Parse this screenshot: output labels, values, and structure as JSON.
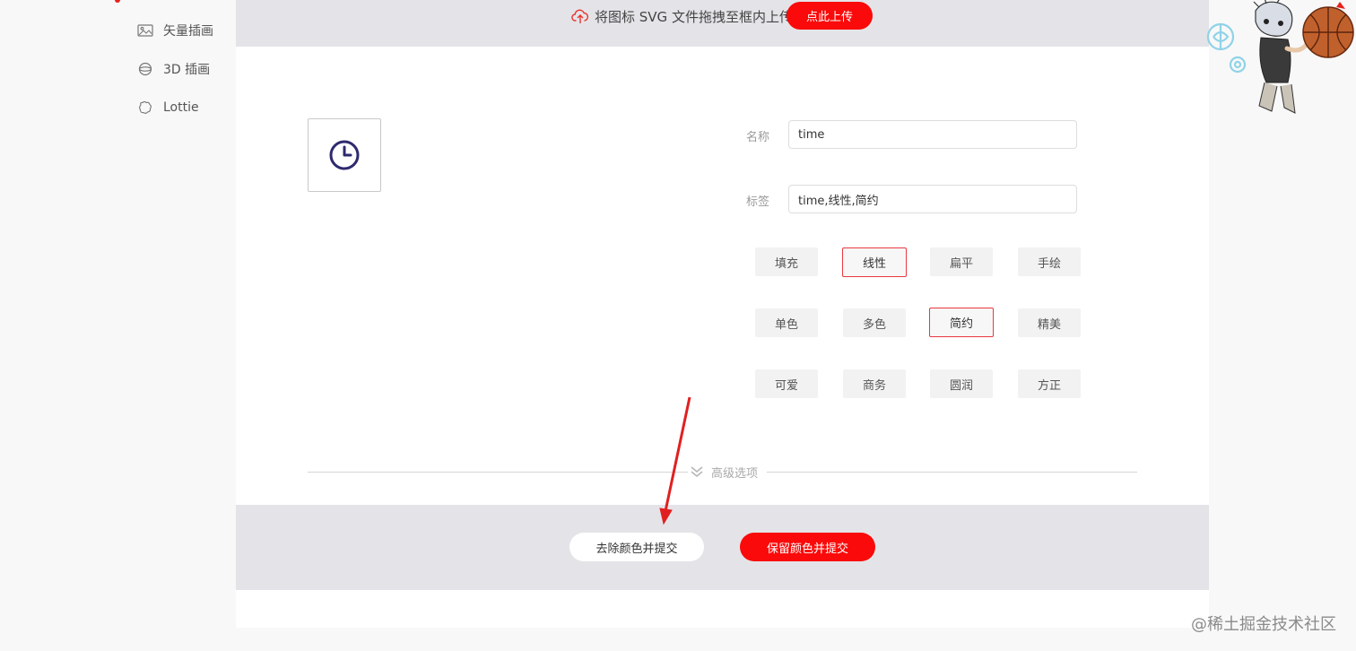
{
  "sidebar": {
    "items": [
      {
        "label": "矢量插画",
        "icon": "image-icon"
      },
      {
        "label": "3D 插画",
        "icon": "sphere-icon"
      },
      {
        "label": "Lottie",
        "icon": "lottie-icon"
      }
    ]
  },
  "upload": {
    "message": "将图标 SVG 文件拖拽至框内上传",
    "button_label": "点此上传",
    "icon": "cloud-upload-icon"
  },
  "preview": {
    "icon": "clock-icon"
  },
  "form": {
    "name_label": "名称",
    "name_value": "time",
    "tags_label": "标签",
    "tags_value": "time,线性,简约"
  },
  "style_tags": {
    "row1": [
      {
        "label": "填充",
        "selected": false
      },
      {
        "label": "线性",
        "selected": true
      },
      {
        "label": "扁平",
        "selected": false
      },
      {
        "label": "手绘",
        "selected": false
      }
    ],
    "row2": [
      {
        "label": "单色",
        "selected": false
      },
      {
        "label": "多色",
        "selected": false
      },
      {
        "label": "简约",
        "selected": true
      },
      {
        "label": "精美",
        "selected": false
      }
    ],
    "row3": [
      {
        "label": "可爱",
        "selected": false
      },
      {
        "label": "商务",
        "selected": false
      },
      {
        "label": "圆润",
        "selected": false
      },
      {
        "label": "方正",
        "selected": false
      }
    ]
  },
  "advanced": {
    "label": "高级选项",
    "icon": "double-chevron-down-icon"
  },
  "actions": {
    "remove_color_label": "去除颜色并提交",
    "keep_color_label": "保留颜色并提交"
  },
  "watermark": "@稀土掘金技术社区",
  "colors": {
    "accent": "#fa0a0a",
    "selected_border": "#e9383f",
    "bar_bg": "#e4e4e8",
    "icon_color": "#2e2a6e"
  }
}
